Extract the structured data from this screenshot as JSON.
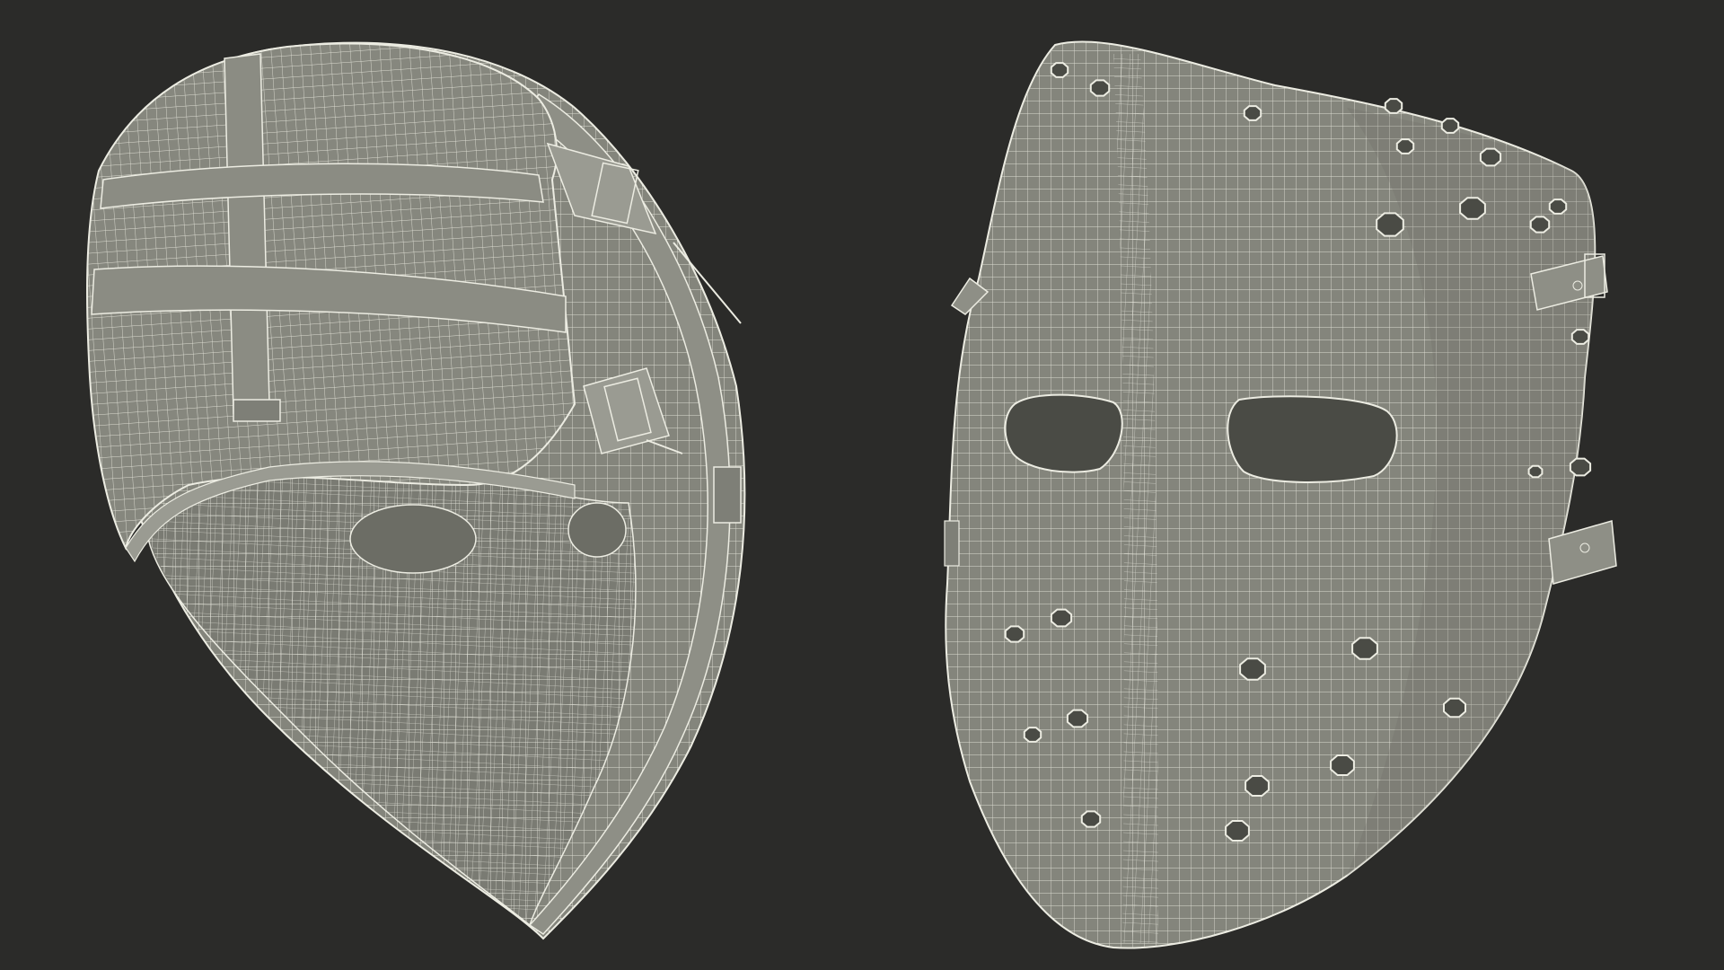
{
  "scene": {
    "background_color": "#2b2b29",
    "mesh_fill_color": "#84857c",
    "mesh_shadow_color": "#6c6d65",
    "wire_color": "#ecece2",
    "hole_color": "#4a4b45"
  },
  "views": [
    {
      "id": "mask-back-view",
      "kind": "mask-rear-with-head-strap",
      "shows": [
        "head-strap",
        "buckles",
        "inner-eye-openings"
      ]
    },
    {
      "id": "mask-front-view",
      "kind": "mask-front",
      "shows": [
        "eye-slots",
        "breathing-holes",
        "side-strap-clips"
      ]
    }
  ]
}
